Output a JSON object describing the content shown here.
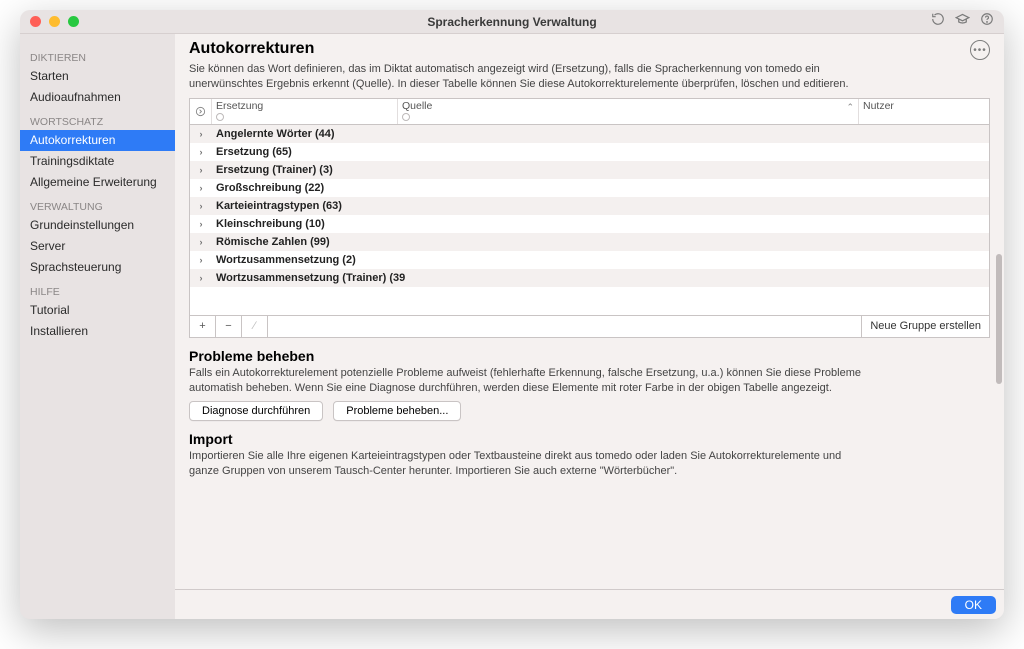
{
  "window": {
    "title": "Spracherkennung Verwaltung"
  },
  "sidebar": {
    "sections": [
      {
        "label": "DIKTIEREN",
        "items": [
          {
            "label": "Starten",
            "selected": false
          },
          {
            "label": "Audioaufnahmen",
            "selected": false
          }
        ]
      },
      {
        "label": "WORTSCHATZ",
        "items": [
          {
            "label": "Autokorrekturen",
            "selected": true
          },
          {
            "label": "Trainingsdiktate",
            "selected": false
          },
          {
            "label": "Allgemeine Erweiterung",
            "selected": false
          }
        ]
      },
      {
        "label": "VERWALTUNG",
        "items": [
          {
            "label": "Grundeinstellungen",
            "selected": false
          },
          {
            "label": "Server",
            "selected": false
          },
          {
            "label": "Sprachsteuerung",
            "selected": false
          }
        ]
      },
      {
        "label": "HILFE",
        "items": [
          {
            "label": "Tutorial",
            "selected": false
          },
          {
            "label": "Installieren",
            "selected": false
          }
        ]
      }
    ]
  },
  "main": {
    "heading": "Autokorrekturen",
    "description": "Sie können das Wort definieren, das im Diktat automatisch angezeigt wird (Ersetzung), falls die Spracherkennung von tomedo ein unerwünschtes Ergebnis erkennt (Quelle). In dieser Tabelle können Sie diese Autokorrekturelemente überprüfen, löschen und editieren.",
    "table": {
      "columns": {
        "ersetzung": "Ersetzung",
        "quelle": "Quelle",
        "nutzer": "Nutzer"
      },
      "rows": [
        {
          "label": "Angelernte Wörter (44)"
        },
        {
          "label": "Ersetzung (65)"
        },
        {
          "label": "Ersetzung (Trainer) (3)"
        },
        {
          "label": "Großschreibung (22)"
        },
        {
          "label": "Karteieintragstypen (63)"
        },
        {
          "label": "Kleinschreibung (10)"
        },
        {
          "label": "Römische Zahlen (99)"
        },
        {
          "label": "Wortzusammensetzung (2)"
        },
        {
          "label": "Wortzusammensetzung (Trainer) (39"
        }
      ],
      "footer": {
        "add": "+",
        "remove": "−",
        "edit": "∕",
        "new_group": "Neue Gruppe erstellen"
      }
    },
    "troubleshoot": {
      "title": "Probleme beheben",
      "desc": "Falls ein Autokorrekturelement potenzielle Probleme aufweist (fehlerhafte Erkennung, falsche Ersetzung, u.a.) können Sie diese Probleme automatish beheben. Wenn Sie eine Diagnose durchführen, werden diese Elemente mit roter Farbe in der obigen Tabelle angezeigt.",
      "diag_btn": "Diagnose durchführen",
      "fix_btn": "Probleme beheben..."
    },
    "import_section": {
      "title": "Import",
      "desc": "Importieren Sie alle Ihre eigenen Karteieintragstypen oder Textbausteine direkt aus tomedo oder laden Sie Autokorrekturelemente und ganze Gruppen von unserem Tausch-Center herunter. Importieren Sie auch externe \"Wörterbücher\"."
    }
  },
  "footer": {
    "ok": "OK"
  }
}
